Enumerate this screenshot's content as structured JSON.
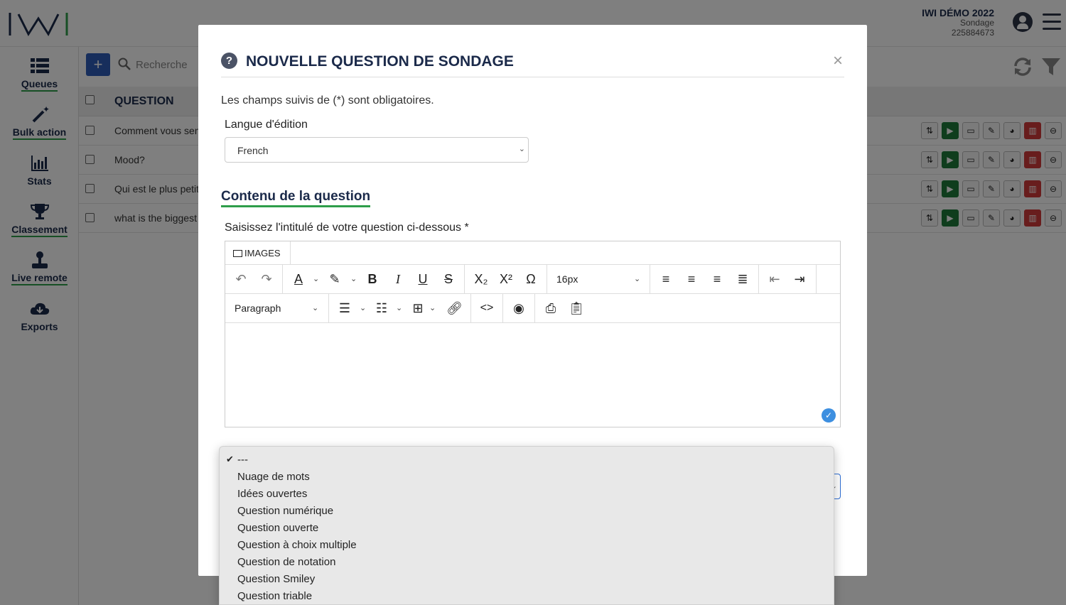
{
  "app": {
    "org": "IWI DÉMO 2022",
    "module": "Sondage",
    "account_id": "225884673"
  },
  "sidebar": {
    "items": [
      {
        "label": "Queues",
        "icon": "list-icon"
      },
      {
        "label": "Bulk action",
        "icon": "magic-wand-icon"
      },
      {
        "label": "Stats",
        "icon": "bar-chart-icon"
      },
      {
        "label": "Classement",
        "icon": "trophy-icon"
      },
      {
        "label": "Live remote",
        "icon": "joystick-icon"
      },
      {
        "label": "Exports",
        "icon": "cloud-download-icon"
      }
    ]
  },
  "toolbar": {
    "add_label": "+",
    "search_placeholder": "Recherche"
  },
  "table": {
    "header": "QUESTION",
    "rows": [
      {
        "question": "Comment vous sen"
      },
      {
        "question": "Mood?"
      },
      {
        "question": "Qui est le plus petit"
      },
      {
        "question": "what is the biggest"
      }
    ],
    "action_icons": [
      "sort-icon",
      "play-icon",
      "monitor-icon",
      "pencil-icon",
      "pie-chart-icon",
      "trash-icon",
      "minus-circle-icon"
    ]
  },
  "modal": {
    "title": "NOUVELLE QUESTION DE SONDAGE",
    "help_icon": "?",
    "close_icon": "×",
    "required_note": "Les champs suivis de (*) sont obligatoires.",
    "language_label": "Langue d'édition",
    "language_value": "French",
    "section_title": "Contenu de la question",
    "question_label": "Saisissez l'intitulé de votre question ci-dessous *",
    "editor": {
      "images_label": "IMAGES",
      "font_size": "16px",
      "block_format": "Paragraph"
    }
  },
  "type_dropdown": {
    "selected": "---",
    "options": [
      "---",
      "Nuage de mots",
      "Idées ouvertes",
      "Question numérique",
      "Question ouverte",
      "Question à choix multiple",
      "Question de notation",
      "Question Smiley",
      "Question triable"
    ]
  },
  "colors": {
    "brand_navy": "#1b2a4a",
    "accent_green": "#2e9e4a",
    "primary_blue": "#2f5db8",
    "danger_red": "#d03a3a"
  }
}
